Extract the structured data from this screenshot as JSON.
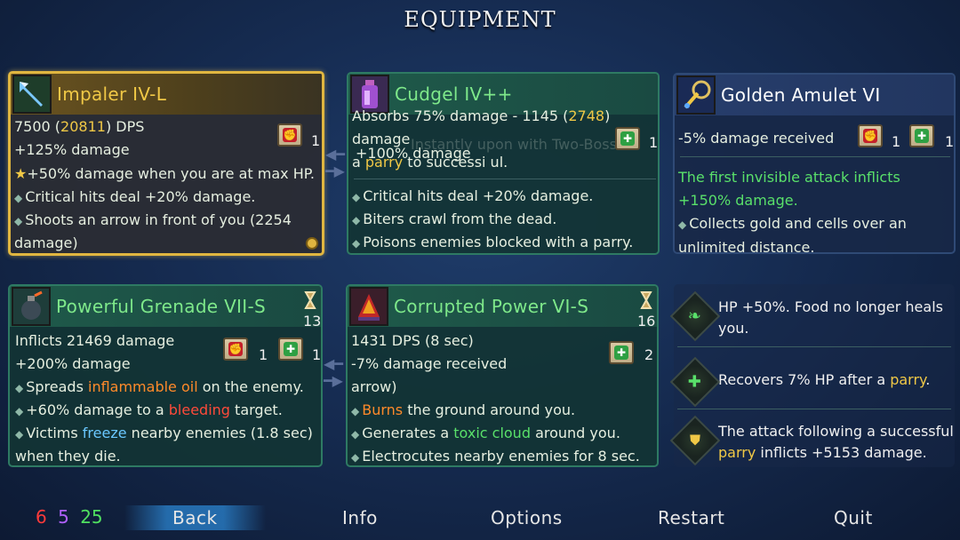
{
  "screen": {
    "title": "EQUIPMENT"
  },
  "cards": {
    "impaler": {
      "name": "Impaler IV-L",
      "dps_value": "7500",
      "dps_open": " (",
      "dps_crit": "20811",
      "dps_close": ") DPS",
      "stat2": "+125% damage",
      "scroll_count": "1",
      "affix1": "+50% damage when you are at max HP.",
      "affix2": "Critical hits deal +20% damage.",
      "affix3a": "Shoots an arrow in front of you (2254",
      "affix3b": "damage)"
    },
    "cudgel": {
      "name": "Cudgel IV++",
      "stat1_pre": "Absorbs 75% damage - 1145 (",
      "stat1_val": "2748",
      "stat1_post": ")",
      "stat2": "damage",
      "stat3_pre": "a ",
      "stat3_key": "parry",
      "stat3_mid": " to successi ul.",
      "overlap": "+100% damage",
      "ghost": "Instantly upon with Two-Boss",
      "scroll_count": "1",
      "affix1": "Critical hits deal +20% damage.",
      "affix2": "Biters crawl from the dead.",
      "affix3": "Poisons enemies blocked with a parry."
    },
    "amulet": {
      "name": "Golden Amulet VI",
      "stat1": "-5% damage received",
      "count_red": "1",
      "count_green": "1",
      "affix1": "The first invisible attack inflicts +150% damage.",
      "affix2": "Collects gold and cells over an unlimited distance."
    },
    "grenade": {
      "name": "Powerful Grenade VII-S",
      "cooldown": "13",
      "stat1": "Inflicts 21469 damage",
      "stat2": "+200% damage",
      "count_red": "1",
      "count_green": "1",
      "affix1_pre": "Spreads ",
      "affix1_key": "inflammable oil",
      "affix1_post": " on the enemy.",
      "affix2_pre": "+60% damage to a ",
      "affix2_key": "bleeding",
      "affix2_post": " target.",
      "affix3_pre": "Victims ",
      "affix3_key": "freeze",
      "affix3_post": " nearby enemies (1.8 sec)",
      "affix3b": "when they die."
    },
    "corrupted": {
      "name": "Corrupted Power VI-S",
      "cooldown": "16",
      "stat1": "1431 DPS (8 sec)",
      "stat2": "-7% damage received",
      "count_green": "2",
      "stat3": "arrow)",
      "affix1_key": "Burns",
      "affix1_post": " the ground around you.",
      "affix2_pre": "Generates a ",
      "affix2_key": "toxic cloud",
      "affix2_post": " around you.",
      "affix3": "Electrocutes nearby enemies for 8 sec."
    }
  },
  "mutations": [
    {
      "icon": "green-leaf-icon",
      "text": "HP +50%. Food no longer heals you."
    },
    {
      "icon": "green-cross-icon",
      "text_pre": "Recovers 7% HP after a ",
      "text_key": "parry",
      "text_post": "."
    },
    {
      "icon": "shield-icon",
      "text_pre": "The attack following a successful ",
      "text_key": "parry",
      "text_post": " inflicts +5153 damage."
    }
  ],
  "footer": {
    "gem_red": "6",
    "gem_purple": "5",
    "gem_green": "25",
    "menu": [
      "Back",
      "Info",
      "Options",
      "Restart",
      "Quit"
    ]
  },
  "colors": {
    "gold": "#f0c846",
    "green": "#7ee88a",
    "red": "#ff4a3a",
    "orange": "#ff8a2a",
    "blue": "#6ac8ff",
    "selected": "#2878be"
  }
}
